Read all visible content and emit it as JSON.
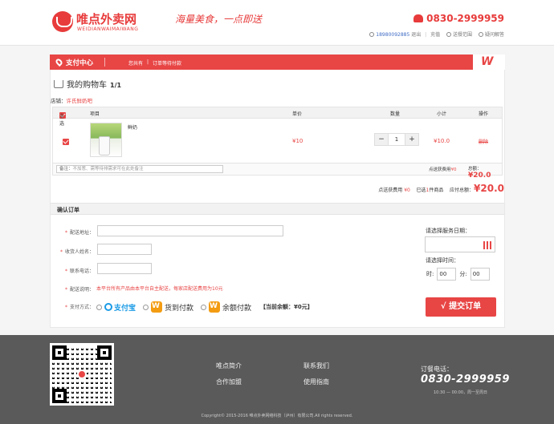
{
  "header": {
    "logo_cn": "唯点外卖网",
    "logo_en": "WEIDIANWAIMAIWANG",
    "slogan": "海量美食，一点即送",
    "hotline": "0830-2999959",
    "user_phone": "18980092885",
    "logout": "退出",
    "recharge": "充值",
    "range": "送餐范围",
    "faq": "疑问解答"
  },
  "paybar": {
    "title": "支付中心",
    "step1": "您共有",
    "step_sep": "|",
    "step2": "订单等待付款"
  },
  "cart": {
    "title": "我的购物车",
    "count": "1/1",
    "store_label": "店铺：",
    "store_name": "许氏鲜奶吧",
    "columns": {
      "select_all": "全选",
      "item": "项目",
      "price": "单价",
      "qty": "数量",
      "subtotal": "小计",
      "action": "操作"
    },
    "items": [
      {
        "name": "鲜奶",
        "price": "¥10",
        "qty": "1",
        "subtotal": "¥10.0",
        "action": "删除"
      }
    ],
    "minus": "−",
    "plus": "+",
    "note_label": "备注：",
    "note_placeholder": "不加葱、需等待排需求可在此处备注",
    "delivery_fee_label": "点送获费用",
    "delivery_fee": "¥0",
    "store_total_label": "总额：",
    "store_total": "¥20.0"
  },
  "summary": {
    "delivery_label": "点送获费用",
    "delivery": "¥0",
    "selected_prefix": "已选",
    "selected_count": "1",
    "selected_suffix": "件商品",
    "total_label": "应付总额：",
    "total": "¥20.0"
  },
  "confirm": {
    "heading": "确认订单",
    "address_label": "配送地址：",
    "name_label": "收货人姓名：",
    "phone_label": "联系电话：",
    "note_label": "配送说明：",
    "note_text": "本平台所有产品由本平台自主配送，每家店配送费用为10元",
    "pay_label": "支付方式：",
    "alipay": "支付宝",
    "cod": "货到付款",
    "balance": "余额付款",
    "balance_note": "【当前余额：¥0元】",
    "date_label": "请选择服务日期：",
    "time_label": "请选择时间：",
    "hour_label": "时:",
    "hour_value": "00",
    "minute_label": "分:",
    "minute_value": "00",
    "submit": "√ 提交订单"
  },
  "footer": {
    "links": [
      "唯点简介",
      "联系我们",
      "合作加盟",
      "使用指南"
    ],
    "tel_label": "订餐电话：",
    "tel": "0830-2999959",
    "hours": "10:30 — 00:00，周一至周日",
    "copyright": "Copyright© 2015-2016 唯点外卖网络科技（泸州）有限公司.All rights reserved."
  },
  "colors": {
    "accent": "#e84545",
    "footer": "#5a5a5a",
    "alipay": "#1a9be6",
    "cod": "#f39c12"
  }
}
